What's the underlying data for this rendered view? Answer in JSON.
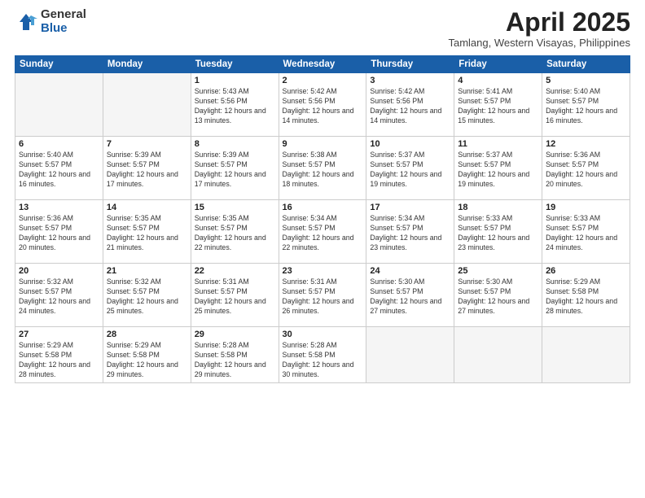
{
  "logo": {
    "general": "General",
    "blue": "Blue"
  },
  "title": "April 2025",
  "subtitle": "Tamlang, Western Visayas, Philippines",
  "days_of_week": [
    "Sunday",
    "Monday",
    "Tuesday",
    "Wednesday",
    "Thursday",
    "Friday",
    "Saturday"
  ],
  "weeks": [
    [
      {
        "day": "",
        "info": ""
      },
      {
        "day": "",
        "info": ""
      },
      {
        "day": "1",
        "info": "Sunrise: 5:43 AM\nSunset: 5:56 PM\nDaylight: 12 hours and 13 minutes."
      },
      {
        "day": "2",
        "info": "Sunrise: 5:42 AM\nSunset: 5:56 PM\nDaylight: 12 hours and 14 minutes."
      },
      {
        "day": "3",
        "info": "Sunrise: 5:42 AM\nSunset: 5:56 PM\nDaylight: 12 hours and 14 minutes."
      },
      {
        "day": "4",
        "info": "Sunrise: 5:41 AM\nSunset: 5:57 PM\nDaylight: 12 hours and 15 minutes."
      },
      {
        "day": "5",
        "info": "Sunrise: 5:40 AM\nSunset: 5:57 PM\nDaylight: 12 hours and 16 minutes."
      }
    ],
    [
      {
        "day": "6",
        "info": "Sunrise: 5:40 AM\nSunset: 5:57 PM\nDaylight: 12 hours and 16 minutes."
      },
      {
        "day": "7",
        "info": "Sunrise: 5:39 AM\nSunset: 5:57 PM\nDaylight: 12 hours and 17 minutes."
      },
      {
        "day": "8",
        "info": "Sunrise: 5:39 AM\nSunset: 5:57 PM\nDaylight: 12 hours and 17 minutes."
      },
      {
        "day": "9",
        "info": "Sunrise: 5:38 AM\nSunset: 5:57 PM\nDaylight: 12 hours and 18 minutes."
      },
      {
        "day": "10",
        "info": "Sunrise: 5:37 AM\nSunset: 5:57 PM\nDaylight: 12 hours and 19 minutes."
      },
      {
        "day": "11",
        "info": "Sunrise: 5:37 AM\nSunset: 5:57 PM\nDaylight: 12 hours and 19 minutes."
      },
      {
        "day": "12",
        "info": "Sunrise: 5:36 AM\nSunset: 5:57 PM\nDaylight: 12 hours and 20 minutes."
      }
    ],
    [
      {
        "day": "13",
        "info": "Sunrise: 5:36 AM\nSunset: 5:57 PM\nDaylight: 12 hours and 20 minutes."
      },
      {
        "day": "14",
        "info": "Sunrise: 5:35 AM\nSunset: 5:57 PM\nDaylight: 12 hours and 21 minutes."
      },
      {
        "day": "15",
        "info": "Sunrise: 5:35 AM\nSunset: 5:57 PM\nDaylight: 12 hours and 22 minutes."
      },
      {
        "day": "16",
        "info": "Sunrise: 5:34 AM\nSunset: 5:57 PM\nDaylight: 12 hours and 22 minutes."
      },
      {
        "day": "17",
        "info": "Sunrise: 5:34 AM\nSunset: 5:57 PM\nDaylight: 12 hours and 23 minutes."
      },
      {
        "day": "18",
        "info": "Sunrise: 5:33 AM\nSunset: 5:57 PM\nDaylight: 12 hours and 23 minutes."
      },
      {
        "day": "19",
        "info": "Sunrise: 5:33 AM\nSunset: 5:57 PM\nDaylight: 12 hours and 24 minutes."
      }
    ],
    [
      {
        "day": "20",
        "info": "Sunrise: 5:32 AM\nSunset: 5:57 PM\nDaylight: 12 hours and 24 minutes."
      },
      {
        "day": "21",
        "info": "Sunrise: 5:32 AM\nSunset: 5:57 PM\nDaylight: 12 hours and 25 minutes."
      },
      {
        "day": "22",
        "info": "Sunrise: 5:31 AM\nSunset: 5:57 PM\nDaylight: 12 hours and 25 minutes."
      },
      {
        "day": "23",
        "info": "Sunrise: 5:31 AM\nSunset: 5:57 PM\nDaylight: 12 hours and 26 minutes."
      },
      {
        "day": "24",
        "info": "Sunrise: 5:30 AM\nSunset: 5:57 PM\nDaylight: 12 hours and 27 minutes."
      },
      {
        "day": "25",
        "info": "Sunrise: 5:30 AM\nSunset: 5:57 PM\nDaylight: 12 hours and 27 minutes."
      },
      {
        "day": "26",
        "info": "Sunrise: 5:29 AM\nSunset: 5:58 PM\nDaylight: 12 hours and 28 minutes."
      }
    ],
    [
      {
        "day": "27",
        "info": "Sunrise: 5:29 AM\nSunset: 5:58 PM\nDaylight: 12 hours and 28 minutes."
      },
      {
        "day": "28",
        "info": "Sunrise: 5:29 AM\nSunset: 5:58 PM\nDaylight: 12 hours and 29 minutes."
      },
      {
        "day": "29",
        "info": "Sunrise: 5:28 AM\nSunset: 5:58 PM\nDaylight: 12 hours and 29 minutes."
      },
      {
        "day": "30",
        "info": "Sunrise: 5:28 AM\nSunset: 5:58 PM\nDaylight: 12 hours and 30 minutes."
      },
      {
        "day": "",
        "info": ""
      },
      {
        "day": "",
        "info": ""
      },
      {
        "day": "",
        "info": ""
      }
    ]
  ]
}
